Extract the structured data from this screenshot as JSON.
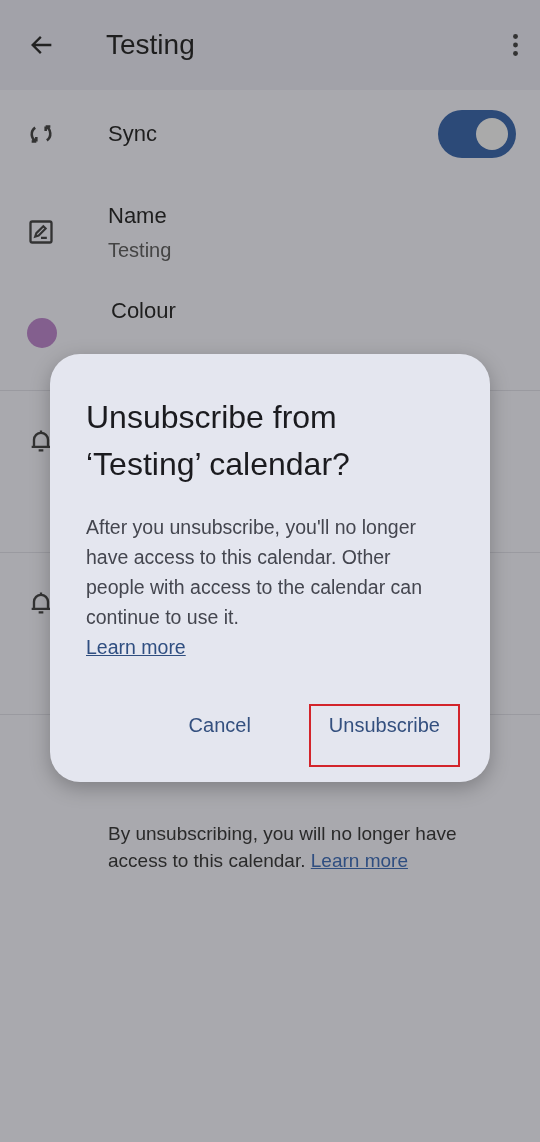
{
  "app_bar": {
    "title": "Testing"
  },
  "settings": [
    {
      "kind": "toggle",
      "label": "Sync",
      "on": true
    },
    {
      "kind": "text",
      "label": "Name",
      "value": "Testing"
    },
    {
      "kind": "colour",
      "label": "Colour",
      "color": "#835f8e"
    },
    {
      "kind": "notification"
    },
    {
      "kind": "notification"
    }
  ],
  "footer": {
    "text": "By unsubscribing, you will no longer have access to this calendar.",
    "link": "Learn more"
  },
  "dialog": {
    "title": "Unsubscribe from ‘Testing’ calendar?",
    "body": "After you unsubscribe, you'll no longer have access to this calendar. Other people with access to the calendar can continue to use it.",
    "link": "Learn more",
    "actions": [
      {
        "label": "Cancel",
        "highlighted": false
      },
      {
        "label": "Unsubscribe",
        "highlighted": true
      }
    ]
  }
}
